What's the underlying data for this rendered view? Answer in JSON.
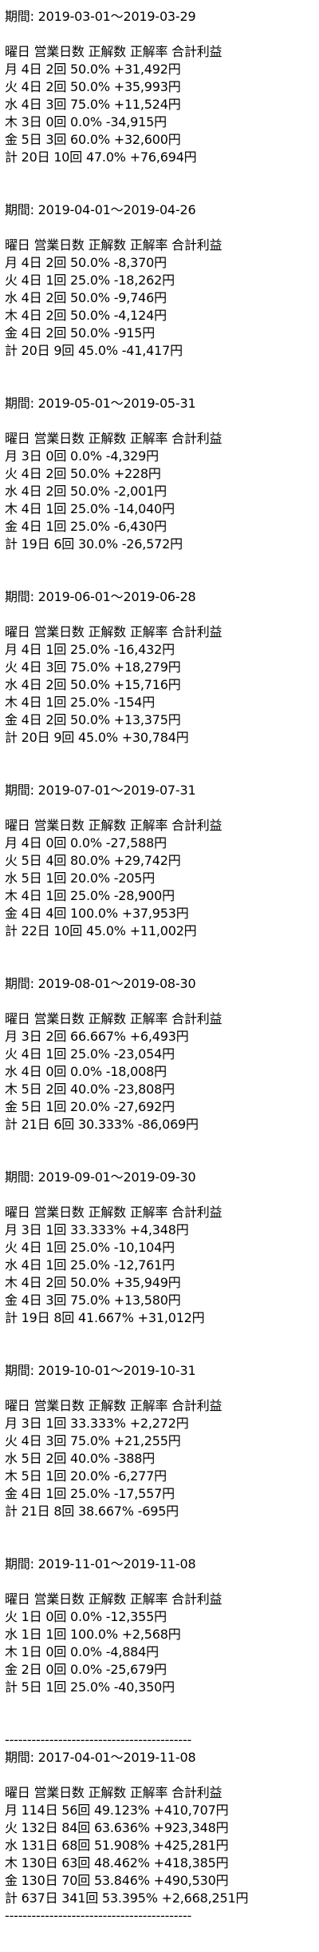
{
  "blocks": [
    {
      "period": "期間: 2019-03-01～2019-03-29",
      "header": "曜日 営業日数 正解数 正解率 合計利益",
      "rows": [
        "月 4日 2回 50.0% +31,492円",
        "火 4日 2回 50.0% +35,993円",
        "水 4日 3回 75.0% +11,524円",
        "木 3日 0回 0.0% -34,915円",
        "金 5日 3回 60.0% +32,600円",
        "計 20日 10回 47.0% +76,694円"
      ]
    },
    {
      "period": "期間: 2019-04-01～2019-04-26",
      "header": "曜日 営業日数 正解数 正解率 合計利益",
      "rows": [
        "月 4日 2回 50.0% -8,370円",
        "火 4日 1回 25.0% -18,262円",
        "水 4日 2回 50.0% -9,746円",
        "木 4日 2回 50.0% -4,124円",
        "金 4日 2回 50.0% -915円",
        "計 20日 9回 45.0% -41,417円"
      ]
    },
    {
      "period": "期間: 2019-05-01～2019-05-31",
      "header": "曜日 営業日数 正解数 正解率 合計利益",
      "rows": [
        "月 3日 0回 0.0% -4,329円",
        "火 4日 2回 50.0% +228円",
        "水 4日 2回 50.0% -2,001円",
        "木 4日 1回 25.0% -14,040円",
        "金 4日 1回 25.0% -6,430円",
        "計 19日 6回 30.0% -26,572円"
      ]
    },
    {
      "period": "期間: 2019-06-01～2019-06-28",
      "header": "曜日 営業日数 正解数 正解率 合計利益",
      "rows": [
        "月 4日 1回 25.0% -16,432円",
        "火 4日 3回 75.0% +18,279円",
        "水 4日 2回 50.0% +15,716円",
        "木 4日 1回 25.0% -154円",
        "金 4日 2回 50.0% +13,375円",
        "計 20日 9回 45.0% +30,784円"
      ]
    },
    {
      "period": "期間: 2019-07-01～2019-07-31",
      "header": "曜日 営業日数 正解数 正解率 合計利益",
      "rows": [
        "月 4日 0回 0.0% -27,588円",
        "火 5日 4回 80.0% +29,742円",
        "水 5日 1回 20.0% -205円",
        "木 4日 1回 25.0% -28,900円",
        "金 4日 4回 100.0% +37,953円",
        "計 22日 10回 45.0% +11,002円"
      ]
    },
    {
      "period": "期間: 2019-08-01～2019-08-30",
      "header": "曜日 営業日数 正解数 正解率 合計利益",
      "rows": [
        "月 3日 2回 66.667% +6,493円",
        "火 4日 1回 25.0% -23,054円",
        "水 4日 0回 0.0% -18,008円",
        "木 5日 2回 40.0% -23,808円",
        "金 5日 1回 20.0% -27,692円",
        "計 21日 6回 30.333% -86,069円"
      ]
    },
    {
      "period": "期間: 2019-09-01～2019-09-30",
      "header": "曜日 営業日数 正解数 正解率 合計利益",
      "rows": [
        "月 3日 1回 33.333% +4,348円",
        "火 4日 1回 25.0% -10,104円",
        "水 4日 1回 25.0% -12,761円",
        "木 4日 2回 50.0% +35,949円",
        "金 4日 3回 75.0% +13,580円",
        "計 19日 8回 41.667% +31,012円"
      ]
    },
    {
      "period": "期間: 2019-10-01～2019-10-31",
      "header": "曜日 営業日数 正解数 正解率 合計利益",
      "rows": [
        "月 3日 1回 33.333% +2,272円",
        "火 4日 3回 75.0% +21,255円",
        "水 5日 2回 40.0% -388円",
        "木 5日 1回 20.0% -6,277円",
        "金 4日 1回 25.0% -17,557円",
        "計 21日 8回 38.667% -695円"
      ]
    },
    {
      "period": "期間: 2019-11-01～2019-11-08",
      "header": "曜日 営業日数 正解数 正解率 合計利益",
      "rows": [
        "火 1日 0回 0.0% -12,355円",
        "水 1日 1回 100.0% +2,568円",
        "木 1日 0回 0.0% -4,884円",
        "金 2日 0回 0.0% -25,679円",
        "計 5日 1回 25.0% -40,350円"
      ]
    }
  ],
  "separator_top": "------------------------------------------",
  "summary": {
    "period": "期間: 2017-04-01～2019-11-08",
    "header": "曜日 営業日数 正解数 正解率 合計利益",
    "rows": [
      "月 114日 56回 49.123% +410,707円",
      "火 132日 84回 63.636% +923,348円",
      "水 131日 68回 51.908% +425,281円",
      "木 130日 63回 48.462% +418,385円",
      "金 130日 70回 53.846% +490,530円",
      "計 637日 341回 53.395% +2,668,251円"
    ]
  },
  "separator_bottom": "------------------------------------------"
}
